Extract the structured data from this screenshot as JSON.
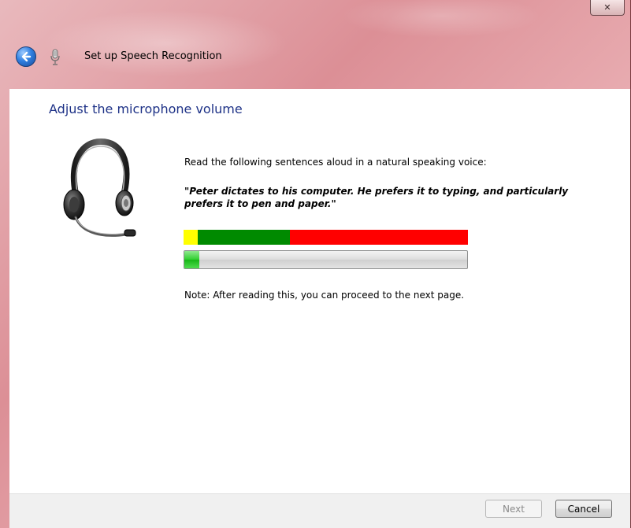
{
  "window": {
    "close_glyph": "✕",
    "title": "Set up Speech Recognition"
  },
  "page": {
    "heading": "Adjust the microphone volume",
    "instruction": "Read the following sentences aloud in a natural speaking voice:",
    "sentence": "\"Peter dictates to his computer. He prefers it to typing, and particularly prefers it to pen and paper.\"",
    "note": "Note: After reading this, you can proceed to the next page."
  },
  "volume_scale": {
    "segments": [
      {
        "zone": "too-low",
        "color": "#ffff00",
        "fraction": 0.05
      },
      {
        "zone": "good",
        "color": "#008a00",
        "fraction": 0.325
      },
      {
        "zone": "too-loud",
        "color": "#ff0000",
        "fraction": 0.625
      }
    ]
  },
  "level_meter": {
    "level_fraction": 0.053
  },
  "footer": {
    "next_label": "Next",
    "cancel_label": "Cancel"
  },
  "icons": {
    "back": "back-arrow-icon",
    "microphone": "microphone-icon",
    "headset": "headset-icon"
  },
  "colors": {
    "heading": "#1e3287",
    "frame": "#dc8f96",
    "meter_fill": "#2fcf2f"
  }
}
